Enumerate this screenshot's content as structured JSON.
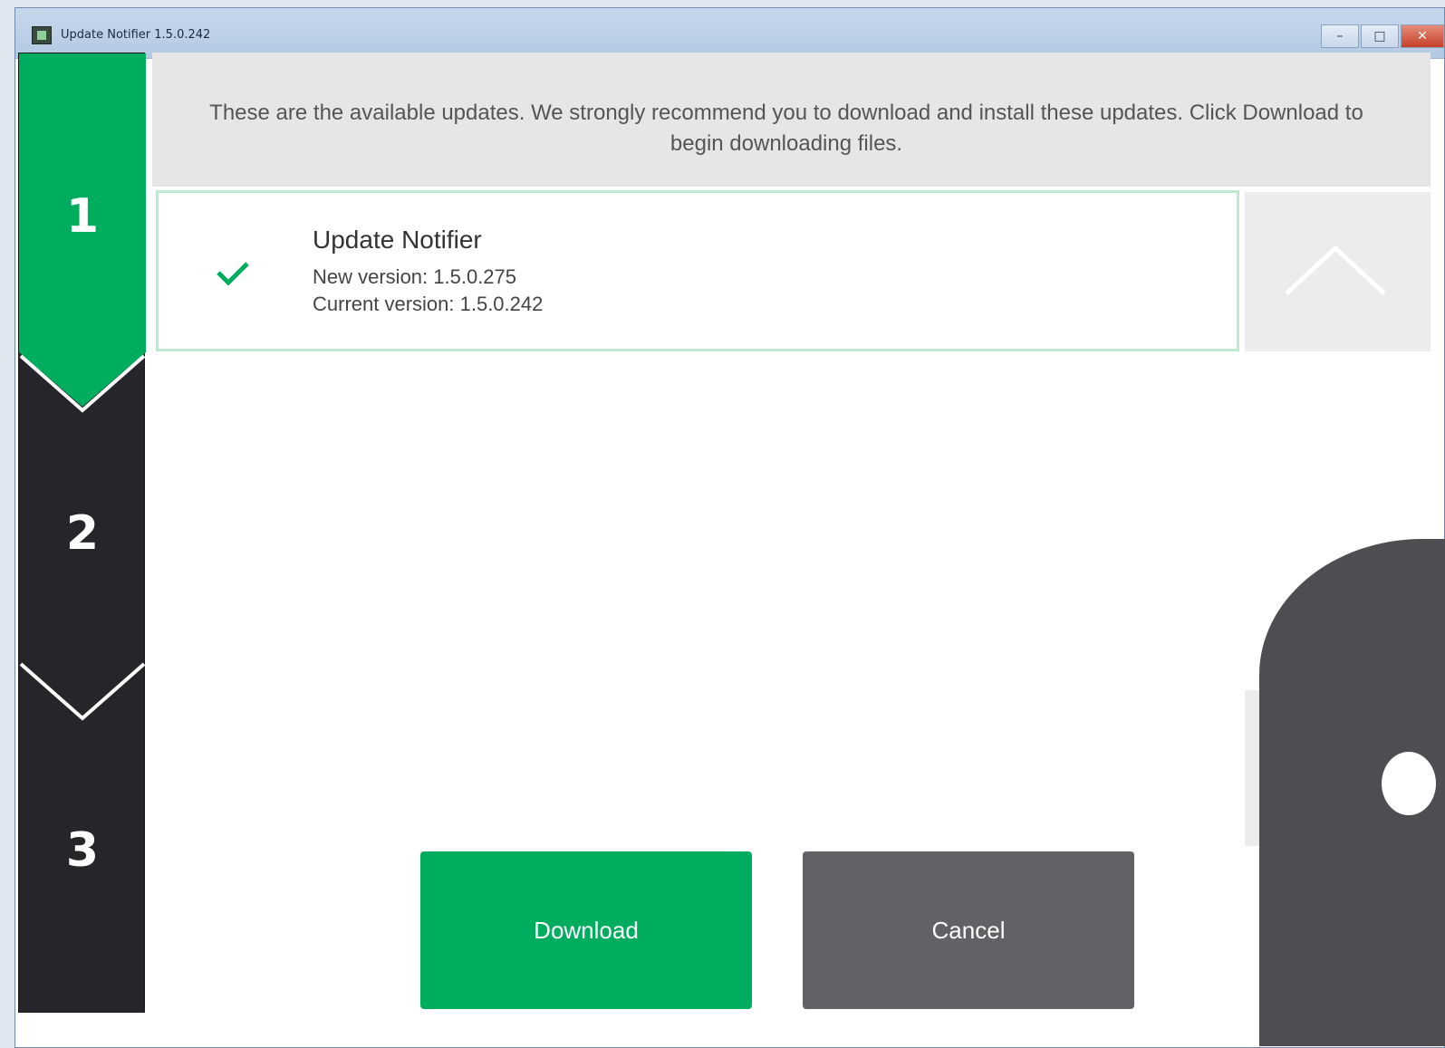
{
  "window": {
    "title": "Update Notifier 1.5.0.242",
    "controls": {
      "minimize": "–",
      "maximize": "□",
      "close": "✕"
    }
  },
  "steps": [
    {
      "number": "1",
      "state": "active"
    },
    {
      "number": "2",
      "state": "inactive"
    },
    {
      "number": "3",
      "state": "inactive"
    }
  ],
  "header": {
    "message": "These are the available updates. We strongly recommend you to download and install these updates. Click Download to begin downloading files."
  },
  "updates": [
    {
      "name": "Update Notifier",
      "new_version": "New version: 1.5.0.275",
      "current_version": "Current version: 1.5.0.242",
      "selected": true
    }
  ],
  "buttons": {
    "download": "Download",
    "cancel": "Cancel"
  },
  "colors": {
    "accent": "#00ad5f",
    "rail": "#26262a",
    "cancel": "#616166"
  }
}
